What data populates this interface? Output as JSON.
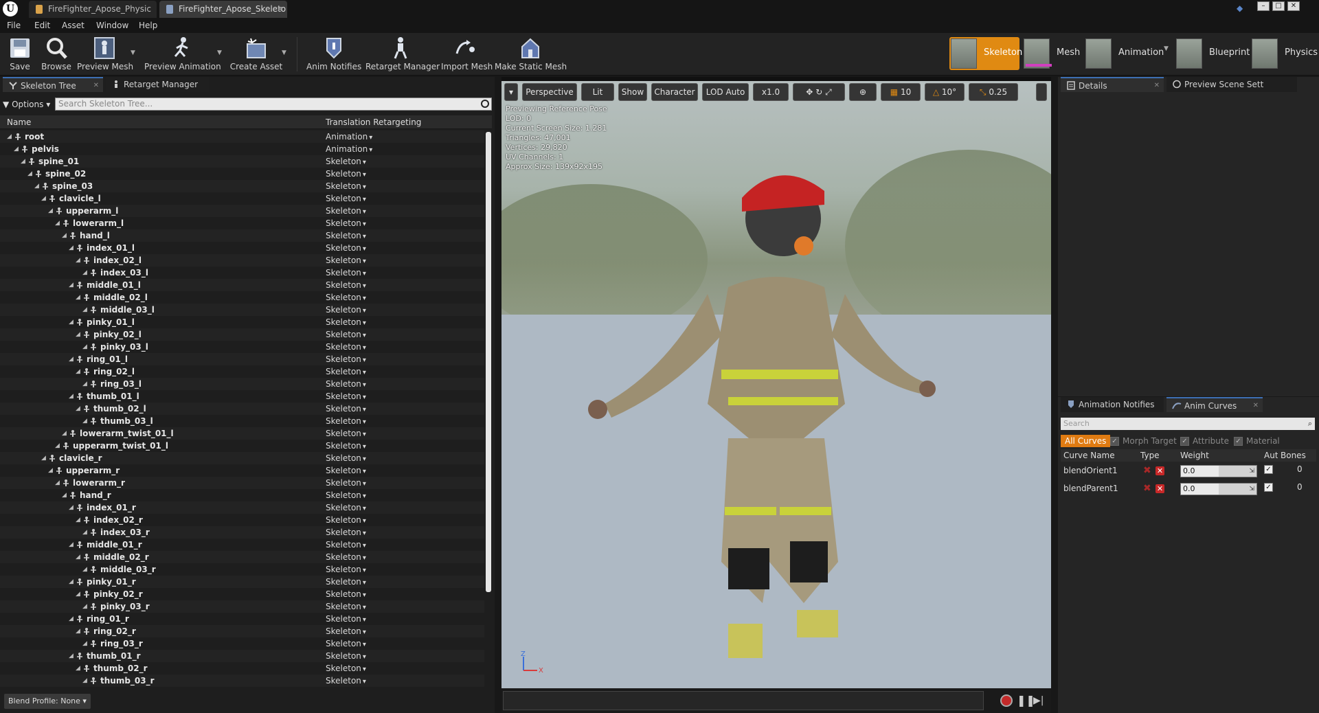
{
  "window": {
    "tabs": [
      {
        "label": "FireFighter_Apose_Physic",
        "active": false
      },
      {
        "label": "FireFighter_Apose_Skeleto",
        "active": true
      }
    ]
  },
  "menu": [
    "File",
    "Edit",
    "Asset",
    "Window",
    "Help"
  ],
  "toolbar": {
    "buttons": [
      "Save",
      "Browse",
      "Preview Mesh",
      "Preview Animation",
      "Create Asset",
      "Anim Notifies",
      "Retarget Manager",
      "Import Mesh",
      "Make Static Mesh"
    ],
    "modes": [
      "Skeleton",
      "Mesh",
      "Animation",
      "Blueprint",
      "Physics"
    ],
    "active_mode": "Skeleton",
    "accent": "#e08a12"
  },
  "left_panel": {
    "tabs": [
      "Skeleton Tree",
      "Retarget Manager"
    ],
    "options_label": "Options",
    "search_placeholder": "Search Skeleton Tree...",
    "columns": [
      "Name",
      "Translation Retargeting"
    ],
    "bones": [
      {
        "name": "root",
        "type": "Animation",
        "depth": 0
      },
      {
        "name": "pelvis",
        "type": "Animation",
        "depth": 1
      },
      {
        "name": "spine_01",
        "type": "Skeleton",
        "depth": 2
      },
      {
        "name": "spine_02",
        "type": "Skeleton",
        "depth": 3
      },
      {
        "name": "spine_03",
        "type": "Skeleton",
        "depth": 4
      },
      {
        "name": "clavicle_l",
        "type": "Skeleton",
        "depth": 5
      },
      {
        "name": "upperarm_l",
        "type": "Skeleton",
        "depth": 6
      },
      {
        "name": "lowerarm_l",
        "type": "Skeleton",
        "depth": 7
      },
      {
        "name": "hand_l",
        "type": "Skeleton",
        "depth": 8
      },
      {
        "name": "index_01_l",
        "type": "Skeleton",
        "depth": 9
      },
      {
        "name": "index_02_l",
        "type": "Skeleton",
        "depth": 10
      },
      {
        "name": "index_03_l",
        "type": "Skeleton",
        "depth": 11
      },
      {
        "name": "middle_01_l",
        "type": "Skeleton",
        "depth": 9
      },
      {
        "name": "middle_02_l",
        "type": "Skeleton",
        "depth": 10
      },
      {
        "name": "middle_03_l",
        "type": "Skeleton",
        "depth": 11
      },
      {
        "name": "pinky_01_l",
        "type": "Skeleton",
        "depth": 9
      },
      {
        "name": "pinky_02_l",
        "type": "Skeleton",
        "depth": 10
      },
      {
        "name": "pinky_03_l",
        "type": "Skeleton",
        "depth": 11
      },
      {
        "name": "ring_01_l",
        "type": "Skeleton",
        "depth": 9
      },
      {
        "name": "ring_02_l",
        "type": "Skeleton",
        "depth": 10
      },
      {
        "name": "ring_03_l",
        "type": "Skeleton",
        "depth": 11
      },
      {
        "name": "thumb_01_l",
        "type": "Skeleton",
        "depth": 9
      },
      {
        "name": "thumb_02_l",
        "type": "Skeleton",
        "depth": 10
      },
      {
        "name": "thumb_03_l",
        "type": "Skeleton",
        "depth": 11
      },
      {
        "name": "lowerarm_twist_01_l",
        "type": "Skeleton",
        "depth": 8
      },
      {
        "name": "upperarm_twist_01_l",
        "type": "Skeleton",
        "depth": 7
      },
      {
        "name": "clavicle_r",
        "type": "Skeleton",
        "depth": 5
      },
      {
        "name": "upperarm_r",
        "type": "Skeleton",
        "depth": 6
      },
      {
        "name": "lowerarm_r",
        "type": "Skeleton",
        "depth": 7
      },
      {
        "name": "hand_r",
        "type": "Skeleton",
        "depth": 8
      },
      {
        "name": "index_01_r",
        "type": "Skeleton",
        "depth": 9
      },
      {
        "name": "index_02_r",
        "type": "Skeleton",
        "depth": 10
      },
      {
        "name": "index_03_r",
        "type": "Skeleton",
        "depth": 11
      },
      {
        "name": "middle_01_r",
        "type": "Skeleton",
        "depth": 9
      },
      {
        "name": "middle_02_r",
        "type": "Skeleton",
        "depth": 10
      },
      {
        "name": "middle_03_r",
        "type": "Skeleton",
        "depth": 11
      },
      {
        "name": "pinky_01_r",
        "type": "Skeleton",
        "depth": 9
      },
      {
        "name": "pinky_02_r",
        "type": "Skeleton",
        "depth": 10
      },
      {
        "name": "pinky_03_r",
        "type": "Skeleton",
        "depth": 11
      },
      {
        "name": "ring_01_r",
        "type": "Skeleton",
        "depth": 9
      },
      {
        "name": "ring_02_r",
        "type": "Skeleton",
        "depth": 10
      },
      {
        "name": "ring_03_r",
        "type": "Skeleton",
        "depth": 11
      },
      {
        "name": "thumb_01_r",
        "type": "Skeleton",
        "depth": 9
      },
      {
        "name": "thumb_02_r",
        "type": "Skeleton",
        "depth": 10
      },
      {
        "name": "thumb_03_r",
        "type": "Skeleton",
        "depth": 11
      }
    ],
    "blend_profile": "Blend Profile: None"
  },
  "viewport": {
    "toolbar": {
      "perspective": "Perspective",
      "lit": "Lit",
      "show": "Show",
      "character": "Character",
      "lod": "LOD Auto",
      "speed": "x1.0",
      "grid": "10",
      "angle": "10°",
      "scale": "0.25"
    },
    "stats": [
      "Previewing Reference Pose",
      "LOD: 0",
      "Current Screen Size: 1.281",
      "Triangles: 47,001",
      "Vertices: 29,820",
      "UV Channels: 1",
      "Approx Size: 139x92x195"
    ],
    "axis": {
      "z": "Z",
      "x": "X"
    }
  },
  "details_panel": {
    "tabs": [
      "Details",
      "Preview Scene Sett"
    ]
  },
  "curves_panel": {
    "tabs": [
      "Animation Notifies",
      "Anim Curves"
    ],
    "search_placeholder": "Search",
    "filters": {
      "all": "All Curves",
      "morph": "Morph Target",
      "attribute": "Attribute",
      "material": "Material"
    },
    "columns": {
      "name": "Curve Name",
      "type": "Type",
      "weight": "Weight",
      "auto": "Auto",
      "bones": "Bones"
    },
    "curves": [
      {
        "name": "blendOrient1",
        "weight": "0.0",
        "bones": "0"
      },
      {
        "name": "blendParent1",
        "weight": "0.0",
        "bones": "0"
      }
    ]
  }
}
